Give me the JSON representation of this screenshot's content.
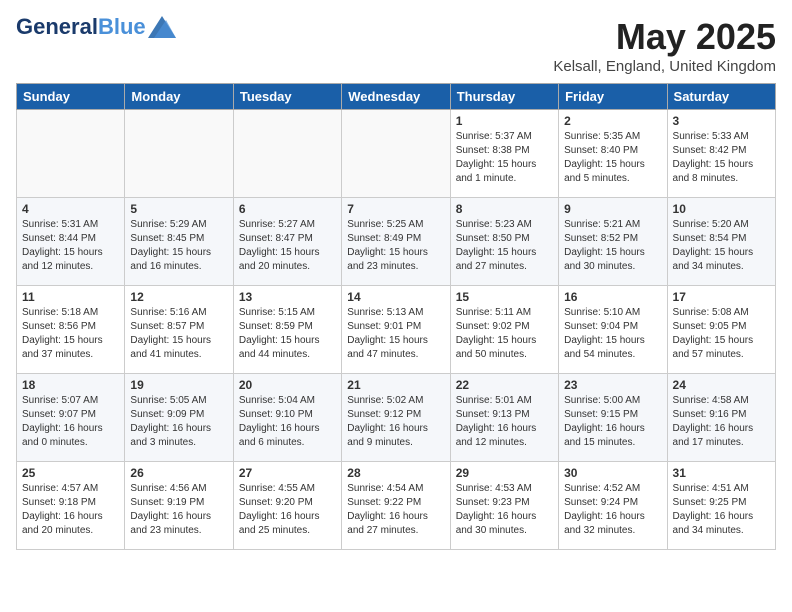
{
  "header": {
    "logo_line1": "General",
    "logo_line2": "Blue",
    "month_title": "May 2025",
    "location": "Kelsall, England, United Kingdom"
  },
  "weekdays": [
    "Sunday",
    "Monday",
    "Tuesday",
    "Wednesday",
    "Thursday",
    "Friday",
    "Saturday"
  ],
  "weeks": [
    [
      {
        "day": "",
        "info": ""
      },
      {
        "day": "",
        "info": ""
      },
      {
        "day": "",
        "info": ""
      },
      {
        "day": "",
        "info": ""
      },
      {
        "day": "1",
        "info": "Sunrise: 5:37 AM\nSunset: 8:38 PM\nDaylight: 15 hours\nand 1 minute."
      },
      {
        "day": "2",
        "info": "Sunrise: 5:35 AM\nSunset: 8:40 PM\nDaylight: 15 hours\nand 5 minutes."
      },
      {
        "day": "3",
        "info": "Sunrise: 5:33 AM\nSunset: 8:42 PM\nDaylight: 15 hours\nand 8 minutes."
      }
    ],
    [
      {
        "day": "4",
        "info": "Sunrise: 5:31 AM\nSunset: 8:44 PM\nDaylight: 15 hours\nand 12 minutes."
      },
      {
        "day": "5",
        "info": "Sunrise: 5:29 AM\nSunset: 8:45 PM\nDaylight: 15 hours\nand 16 minutes."
      },
      {
        "day": "6",
        "info": "Sunrise: 5:27 AM\nSunset: 8:47 PM\nDaylight: 15 hours\nand 20 minutes."
      },
      {
        "day": "7",
        "info": "Sunrise: 5:25 AM\nSunset: 8:49 PM\nDaylight: 15 hours\nand 23 minutes."
      },
      {
        "day": "8",
        "info": "Sunrise: 5:23 AM\nSunset: 8:50 PM\nDaylight: 15 hours\nand 27 minutes."
      },
      {
        "day": "9",
        "info": "Sunrise: 5:21 AM\nSunset: 8:52 PM\nDaylight: 15 hours\nand 30 minutes."
      },
      {
        "day": "10",
        "info": "Sunrise: 5:20 AM\nSunset: 8:54 PM\nDaylight: 15 hours\nand 34 minutes."
      }
    ],
    [
      {
        "day": "11",
        "info": "Sunrise: 5:18 AM\nSunset: 8:56 PM\nDaylight: 15 hours\nand 37 minutes."
      },
      {
        "day": "12",
        "info": "Sunrise: 5:16 AM\nSunset: 8:57 PM\nDaylight: 15 hours\nand 41 minutes."
      },
      {
        "day": "13",
        "info": "Sunrise: 5:15 AM\nSunset: 8:59 PM\nDaylight: 15 hours\nand 44 minutes."
      },
      {
        "day": "14",
        "info": "Sunrise: 5:13 AM\nSunset: 9:01 PM\nDaylight: 15 hours\nand 47 minutes."
      },
      {
        "day": "15",
        "info": "Sunrise: 5:11 AM\nSunset: 9:02 PM\nDaylight: 15 hours\nand 50 minutes."
      },
      {
        "day": "16",
        "info": "Sunrise: 5:10 AM\nSunset: 9:04 PM\nDaylight: 15 hours\nand 54 minutes."
      },
      {
        "day": "17",
        "info": "Sunrise: 5:08 AM\nSunset: 9:05 PM\nDaylight: 15 hours\nand 57 minutes."
      }
    ],
    [
      {
        "day": "18",
        "info": "Sunrise: 5:07 AM\nSunset: 9:07 PM\nDaylight: 16 hours\nand 0 minutes."
      },
      {
        "day": "19",
        "info": "Sunrise: 5:05 AM\nSunset: 9:09 PM\nDaylight: 16 hours\nand 3 minutes."
      },
      {
        "day": "20",
        "info": "Sunrise: 5:04 AM\nSunset: 9:10 PM\nDaylight: 16 hours\nand 6 minutes."
      },
      {
        "day": "21",
        "info": "Sunrise: 5:02 AM\nSunset: 9:12 PM\nDaylight: 16 hours\nand 9 minutes."
      },
      {
        "day": "22",
        "info": "Sunrise: 5:01 AM\nSunset: 9:13 PM\nDaylight: 16 hours\nand 12 minutes."
      },
      {
        "day": "23",
        "info": "Sunrise: 5:00 AM\nSunset: 9:15 PM\nDaylight: 16 hours\nand 15 minutes."
      },
      {
        "day": "24",
        "info": "Sunrise: 4:58 AM\nSunset: 9:16 PM\nDaylight: 16 hours\nand 17 minutes."
      }
    ],
    [
      {
        "day": "25",
        "info": "Sunrise: 4:57 AM\nSunset: 9:18 PM\nDaylight: 16 hours\nand 20 minutes."
      },
      {
        "day": "26",
        "info": "Sunrise: 4:56 AM\nSunset: 9:19 PM\nDaylight: 16 hours\nand 23 minutes."
      },
      {
        "day": "27",
        "info": "Sunrise: 4:55 AM\nSunset: 9:20 PM\nDaylight: 16 hours\nand 25 minutes."
      },
      {
        "day": "28",
        "info": "Sunrise: 4:54 AM\nSunset: 9:22 PM\nDaylight: 16 hours\nand 27 minutes."
      },
      {
        "day": "29",
        "info": "Sunrise: 4:53 AM\nSunset: 9:23 PM\nDaylight: 16 hours\nand 30 minutes."
      },
      {
        "day": "30",
        "info": "Sunrise: 4:52 AM\nSunset: 9:24 PM\nDaylight: 16 hours\nand 32 minutes."
      },
      {
        "day": "31",
        "info": "Sunrise: 4:51 AM\nSunset: 9:25 PM\nDaylight: 16 hours\nand 34 minutes."
      }
    ]
  ]
}
